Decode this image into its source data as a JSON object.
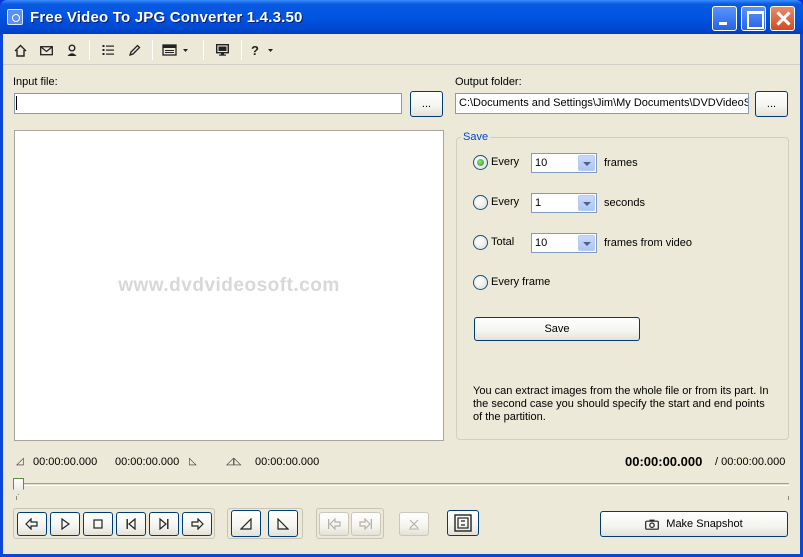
{
  "window": {
    "title": "Free Video To JPG Converter 1.4.3.50"
  },
  "toolbar": {
    "icons": [
      "home-icon",
      "mail-icon",
      "user-icon",
      "list-icon",
      "pen-icon",
      "menu-dropdown-icon",
      "screen-icon",
      "help-icon"
    ],
    "help_glyph": "?"
  },
  "input": {
    "label": "Input file:",
    "value": "",
    "browse_label": "..."
  },
  "output": {
    "label": "Output folder:",
    "value": "C:\\Documents and Settings\\Jim\\My Documents\\DVDVideoSo",
    "browse_label": "..."
  },
  "preview": {
    "watermark": "www.dvdvideosoft.com"
  },
  "save_group": {
    "title": "Save",
    "options": [
      {
        "label": "Every",
        "value": "10",
        "suffix": "frames",
        "checked": true
      },
      {
        "label": "Every",
        "value": "1",
        "suffix": "seconds",
        "checked": false
      },
      {
        "label": "Total",
        "value": "10",
        "suffix": "frames from video",
        "checked": false
      },
      {
        "label": "Every frame",
        "checked": false
      }
    ],
    "save_button": "Save",
    "info": "You can extract images from the whole file or from its part. In the second case you should specify the start and end points of the partition."
  },
  "timeline": {
    "start_time": "00:00:00.000",
    "end_time": "00:00:00.000",
    "duration": "00:00:00.000",
    "current_time": "00:00:00.000",
    "total_time": "/ 00:00:00.000",
    "position": 0
  },
  "bottom": {
    "make_snapshot_label": "Make Snapshot"
  }
}
